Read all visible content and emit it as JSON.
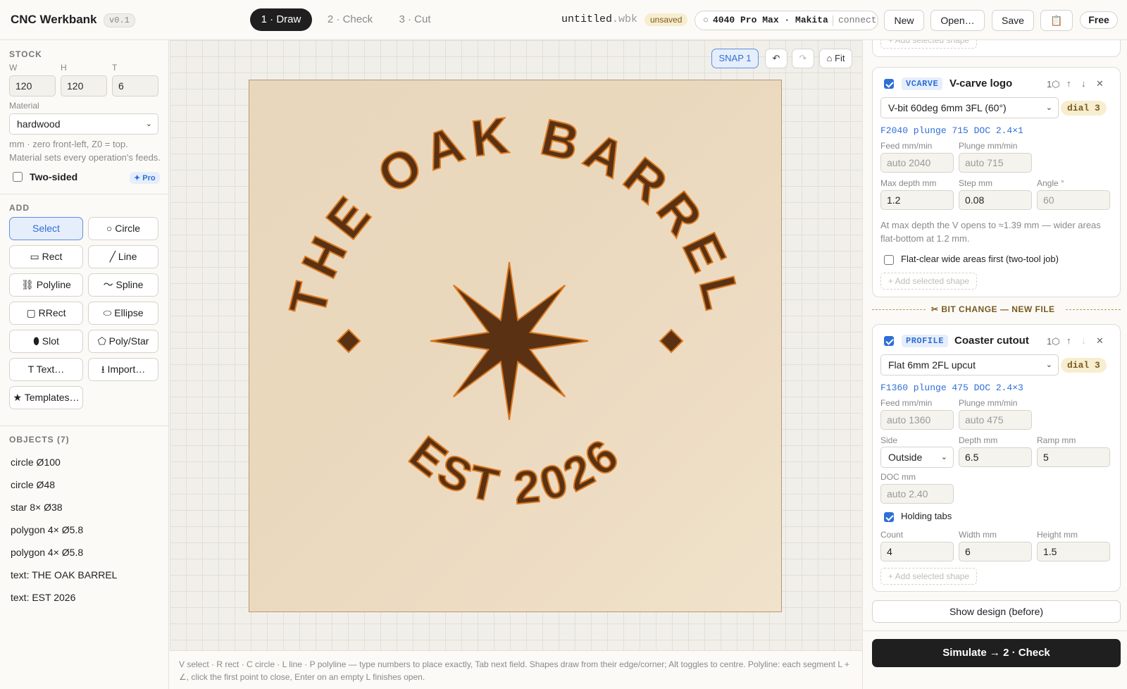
{
  "app": {
    "title": "CNC Werkbank",
    "version": "v0.1"
  },
  "steps": [
    {
      "label": "1 · Draw",
      "active": true
    },
    {
      "label": "2 · Check",
      "active": false
    },
    {
      "label": "3 · Cut",
      "active": false
    }
  ],
  "file": {
    "name": "untitled",
    "ext": ".wbk",
    "status": "unsaved"
  },
  "machine": {
    "icon": "circle-icon",
    "glyph": "○",
    "name": "4040 Pro Max · Makita",
    "connect_label": "connect"
  },
  "toolbar": {
    "new": "New",
    "open": "Open…",
    "save": "Save",
    "clipboard_icon": "📋",
    "plan": "Free"
  },
  "stock": {
    "heading": "STOCK",
    "w_label": "W",
    "h_label": "H",
    "t_label": "T",
    "w": "120",
    "h": "120",
    "t": "6",
    "material_label": "Material",
    "material": "hardwood",
    "note": "mm · zero front-left, Z0 = top. Material sets every operation's feeds.",
    "two_sided_label": "Two-sided",
    "two_sided": false,
    "pro_badge": "✦ Pro"
  },
  "add": {
    "heading": "ADD",
    "tools": [
      "Select",
      "○ Circle",
      "▭ Rect",
      "╱ Line",
      "⛓ Polyline",
      "〜 Spline",
      "▢ RRect",
      "⬭ Ellipse",
      "⬮ Slot",
      "⬠ Poly/Star",
      "T Text…",
      "⭳ Import…",
      "★ Templates…"
    ],
    "selected": "Select"
  },
  "objects": {
    "heading": "OBJECTS (7)",
    "items": [
      "circle Ø100",
      "circle Ø48",
      "star 8× Ø38",
      "polygon 4× Ø5.8",
      "polygon 4× Ø5.8",
      "text: THE OAK BARREL",
      "text: EST 2026"
    ]
  },
  "canvas": {
    "snap": "SNAP 1",
    "undo": "↶",
    "redo": "↷",
    "fit": "⌂ Fit",
    "design": {
      "arc_top": "THE OAK BARREL",
      "arc_bottom": "EST 2026",
      "star_points": 8,
      "fill": "#5a3213",
      "stroke": "#d9771e",
      "stock_color": "#e8d7bd"
    }
  },
  "footer_hint": "V select · R rect · C circle · L line · P polyline — type numbers to place exactly, Tab next field. Shapes draw from their edge/corner; Alt toggles to centre. Polyline: each segment L + ∠, click the first point to close, Enter on an empty L finishes open.",
  "operations": {
    "add_selected_label": "+ Add selected shape",
    "vcarve": {
      "enabled": true,
      "type": "VCARVE",
      "title": "V-carve logo",
      "count": "1⬡",
      "up": "↑",
      "down": "↓",
      "remove": "✕",
      "tool": "V-bit 60deg 6mm 3FL (60°)",
      "dial": "dial 3",
      "feeds": "F2040  plunge 715  DOC 2.4×1",
      "feed_label": "Feed mm/min",
      "feed_placeholder": "auto 2040",
      "plunge_label": "Plunge mm/min",
      "plunge_placeholder": "auto 715",
      "maxdepth_label": "Max depth mm",
      "maxdepth": "1.2",
      "step_label": "Step mm",
      "step": "0.08",
      "angle_label": "Angle °",
      "angle": "60",
      "note": "At max depth the V opens to ≈1.39 mm — wider areas flat-bottom at 1.2 mm.",
      "flatclear_label": "Flat-clear wide areas first (two-tool job)",
      "flatclear": false
    },
    "bit_change": "✂ BIT CHANGE — NEW FILE",
    "profile": {
      "enabled": true,
      "type": "PROFILE",
      "title": "Coaster cutout",
      "count": "1⬡",
      "up": "↑",
      "down": "↓",
      "remove": "✕",
      "tool": "Flat 6mm 2FL upcut",
      "dial": "dial 3",
      "feeds": "F1360  plunge 475  DOC 2.4×3",
      "feed_label": "Feed mm/min",
      "feed_placeholder": "auto 1360",
      "plunge_label": "Plunge mm/min",
      "plunge_placeholder": "auto 475",
      "side_label": "Side",
      "side": "Outside",
      "depth_label": "Depth mm",
      "depth": "6.5",
      "ramp_label": "Ramp mm",
      "ramp": "5",
      "doc_label": "DOC mm",
      "doc_placeholder": "auto 2.40",
      "tabs_label": "Holding tabs",
      "tabs": true,
      "count_label": "Count",
      "tab_count": "4",
      "width_label": "Width mm",
      "tab_width": "6",
      "height_label": "Height mm",
      "tab_height": "1.5"
    }
  },
  "show_design": "Show design (before)",
  "simulate": "Simulate → 2 · Check"
}
